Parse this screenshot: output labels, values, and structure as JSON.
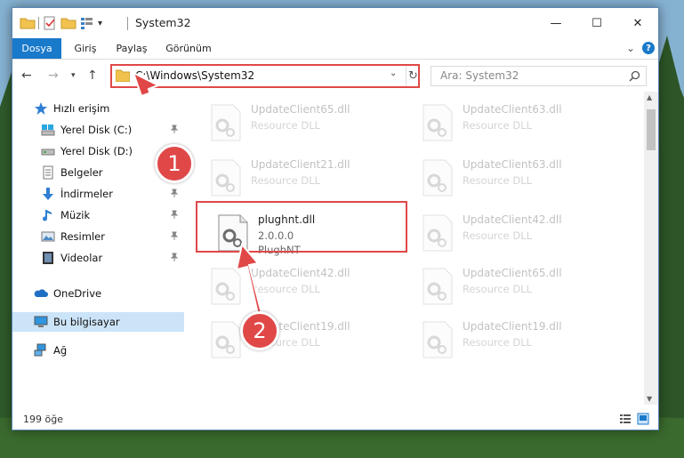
{
  "window": {
    "title": "System32"
  },
  "ribbon": {
    "tabs": [
      {
        "label": "Dosya",
        "active": true
      },
      {
        "label": "Giriş",
        "active": false
      },
      {
        "label": "Paylaş",
        "active": false
      },
      {
        "label": "Görünüm",
        "active": false
      }
    ],
    "help": "?",
    "expand": "⌄"
  },
  "window_controls": {
    "minimize": "—",
    "maximize": "☐",
    "close": "✕"
  },
  "address": {
    "path": "C:\\Windows\\System32",
    "dropdown": "⌄",
    "refresh": "↻"
  },
  "search": {
    "placeholder": "Ara: System32"
  },
  "sidebar": {
    "items": [
      {
        "label": "Hızlı erişim",
        "icon": "star-icon",
        "pinned": false
      },
      {
        "label": "Yerel Disk (C:)",
        "icon": "drive-icon",
        "pinned": true
      },
      {
        "label": "Yerel Disk (D:)",
        "icon": "drive-icon",
        "pinned": false
      },
      {
        "label": "Belgeler",
        "icon": "document-icon",
        "pinned": false
      },
      {
        "label": "İndirmeler",
        "icon": "download-icon",
        "pinned": true
      },
      {
        "label": "Müzik",
        "icon": "music-icon",
        "pinned": true
      },
      {
        "label": "Resimler",
        "icon": "pictures-icon",
        "pinned": true
      },
      {
        "label": "Videolar",
        "icon": "video-icon",
        "pinned": true
      },
      {
        "label": "OneDrive",
        "icon": "cloud-icon",
        "pinned": false
      },
      {
        "label": "Bu bilgisayar",
        "icon": "computer-icon",
        "pinned": false,
        "selected": true
      },
      {
        "label": "Ağ",
        "icon": "network-icon",
        "pinned": false
      }
    ]
  },
  "files": [
    {
      "name": "UpdateClient65.dll",
      "desc": "Resource DLL",
      "faded": true
    },
    {
      "name": "UpdateClient63.dll",
      "desc": "Resource DLL",
      "faded": true
    },
    {
      "name": "UpdateClient21.dll",
      "desc": "Resource DLL",
      "faded": true
    },
    {
      "name": "UpdateClient63.dll",
      "desc": "Resource DLL",
      "faded": true
    },
    {
      "name": "plughnt.dll",
      "version": "2.0.0.0",
      "desc": "PlughNT",
      "faded": false
    },
    {
      "name": "UpdateClient42.dll",
      "desc": "Resource DLL",
      "faded": true
    },
    {
      "name": "UpdateClient42.dll",
      "desc": "Resource DLL",
      "faded": true
    },
    {
      "name": "UpdateClient65.dll",
      "desc": "Resource DLL",
      "faded": true
    },
    {
      "name": "UpdateClient19.dll",
      "desc": "Resource DLL",
      "faded": true
    },
    {
      "name": "UpdateClient19.dll",
      "desc": "Resource DLL",
      "faded": true
    }
  ],
  "status": {
    "item_count": "199 öğe"
  },
  "annotations": [
    {
      "label": "1"
    },
    {
      "label": "2"
    }
  ],
  "colors": {
    "accent": "#1979ca",
    "highlight": "#e04848",
    "selected": "#cce4f7"
  }
}
